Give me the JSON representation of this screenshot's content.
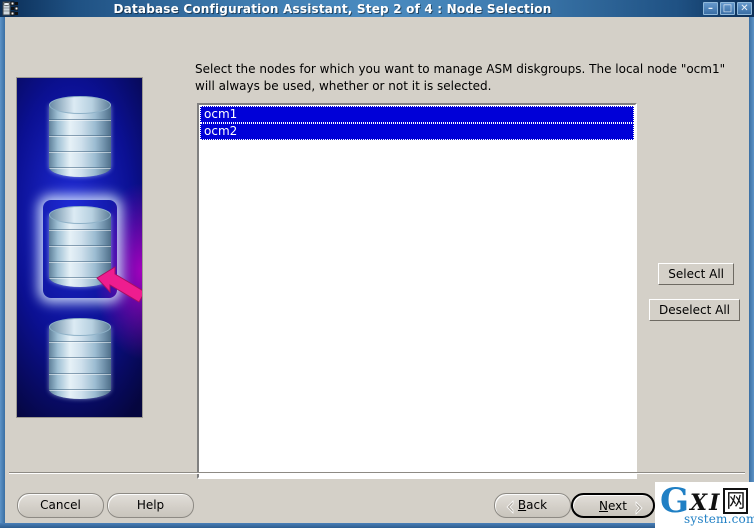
{
  "window": {
    "title": "Database Configuration Assistant, Step 2 of 4 : Node Selection",
    "app_icon": "database-assistant-icon",
    "controls": {
      "minimize": "–",
      "maximize": "□",
      "close": "✕"
    }
  },
  "main": {
    "instruction": "Select the nodes for which you want to manage ASM diskgroups.  The local node \"ocm1\" will always be used, whether or not it is selected.",
    "node_list": {
      "name": "node-selection-list",
      "items": [
        {
          "label": "ocm1",
          "selected": true
        },
        {
          "label": "ocm2",
          "selected": true
        }
      ]
    },
    "side_buttons": {
      "select_all": "Select All",
      "deselect_all": "Deselect All"
    },
    "artwork": {
      "alt": "three-database-cylinders-with-arrow",
      "cylinder_count": 3,
      "highlighted_index": 2,
      "arrow_color": "#ee1d8f"
    }
  },
  "footer": {
    "cancel": "Cancel",
    "help": "Help",
    "back": "Back",
    "back_mnemonic": "B",
    "back_rest": "ack",
    "next": "Next",
    "next_mnemonic": "N",
    "next_rest": "ext"
  },
  "watermark": {
    "g": "G",
    "xi": "XI",
    "cjk": "网",
    "sub": "system.com",
    "accent_color": "#1f7fc4"
  },
  "colors": {
    "titlebar_start": "#0a2d56",
    "titlebar_mid": "#4a8bc0",
    "dialog_face": "#d4d0c8",
    "selection_blue": "#0000d8",
    "list_background": "#ffffff",
    "art_blue": "#1f2bd8",
    "art_magenta": "#be00c8"
  }
}
